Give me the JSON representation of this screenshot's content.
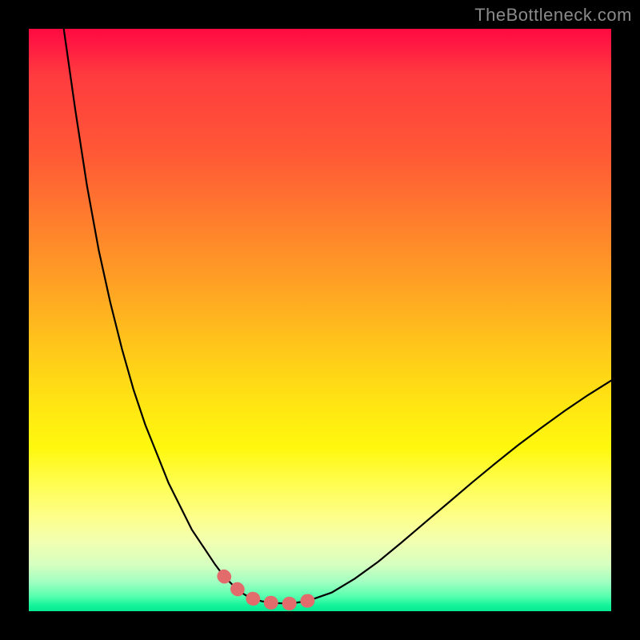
{
  "watermark": "TheBottleneck.com",
  "colors": {
    "frame": "#000000",
    "curve": "#000000",
    "highlight": "#e26b6b",
    "gradient_top": "#ff0a40",
    "gradient_bottom": "#06e892"
  },
  "chart_data": {
    "type": "line",
    "title": "",
    "xlabel": "",
    "ylabel": "",
    "xlim": [
      0,
      100
    ],
    "ylim": [
      0,
      100
    ],
    "x": [
      6,
      8,
      10,
      12,
      14,
      16,
      18,
      20,
      22,
      24,
      26,
      28,
      30,
      32,
      33.5,
      35,
      36.5,
      38,
      40,
      42,
      45,
      48,
      52,
      56,
      60,
      64,
      68,
      72,
      76,
      80,
      84,
      88,
      92,
      96,
      100
    ],
    "y": [
      100,
      86,
      73,
      62,
      53,
      45,
      38,
      32,
      27,
      22,
      18,
      14,
      11,
      8,
      6,
      4.5,
      3.2,
      2.3,
      1.7,
      1.4,
      1.3,
      1.8,
      3.2,
      5.6,
      8.5,
      11.8,
      15.2,
      18.6,
      22,
      25.3,
      28.5,
      31.5,
      34.4,
      37.1,
      39.6
    ],
    "series": [
      {
        "name": "bottleneck-curve",
        "style": "line",
        "color": "#000000"
      },
      {
        "name": "optimal-range-highlight",
        "style": "dotted-thick",
        "color": "#e26b6b",
        "x_range": [
          33,
          50
        ]
      }
    ],
    "annotations": []
  }
}
